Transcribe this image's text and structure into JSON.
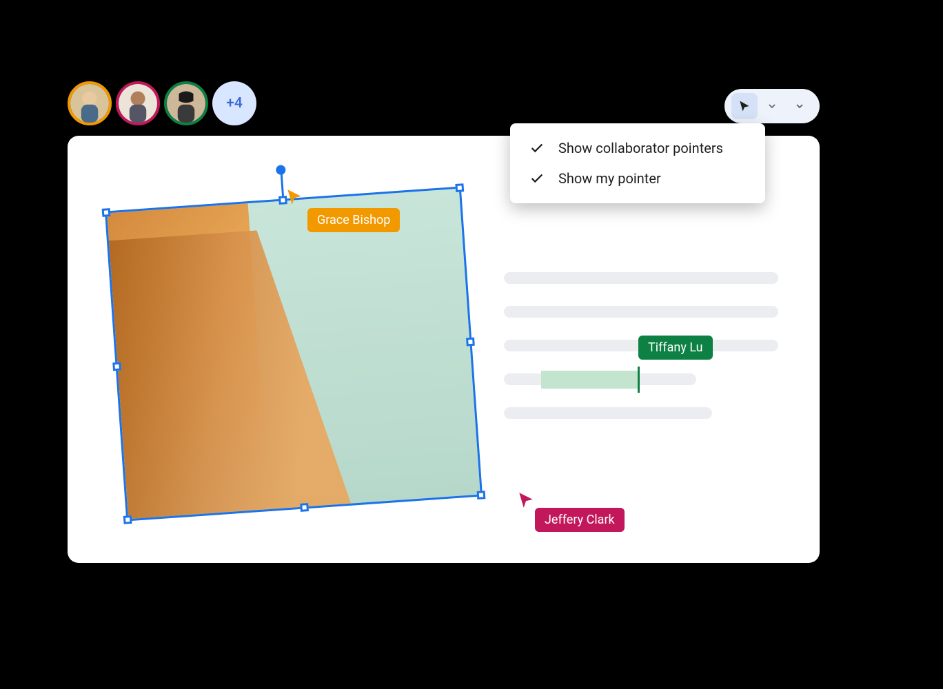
{
  "avatars": {
    "ring_colors": [
      "#f29900",
      "#c2185b",
      "#0d8043"
    ],
    "overflow_label": "+4"
  },
  "toolbar": {
    "cursor_active": true
  },
  "dropdown": {
    "items": [
      {
        "label": "Show collaborator pointers",
        "checked": true
      },
      {
        "label": "Show my pointer",
        "checked": true
      }
    ]
  },
  "collaborators": {
    "grace": {
      "name": "Grace Bishop",
      "color": "#f29900"
    },
    "jeffery": {
      "name": "Jeffery Clark",
      "color": "#c2185b"
    },
    "tiffany": {
      "name": "Tiffany Lu",
      "color": "#0d8043"
    }
  }
}
